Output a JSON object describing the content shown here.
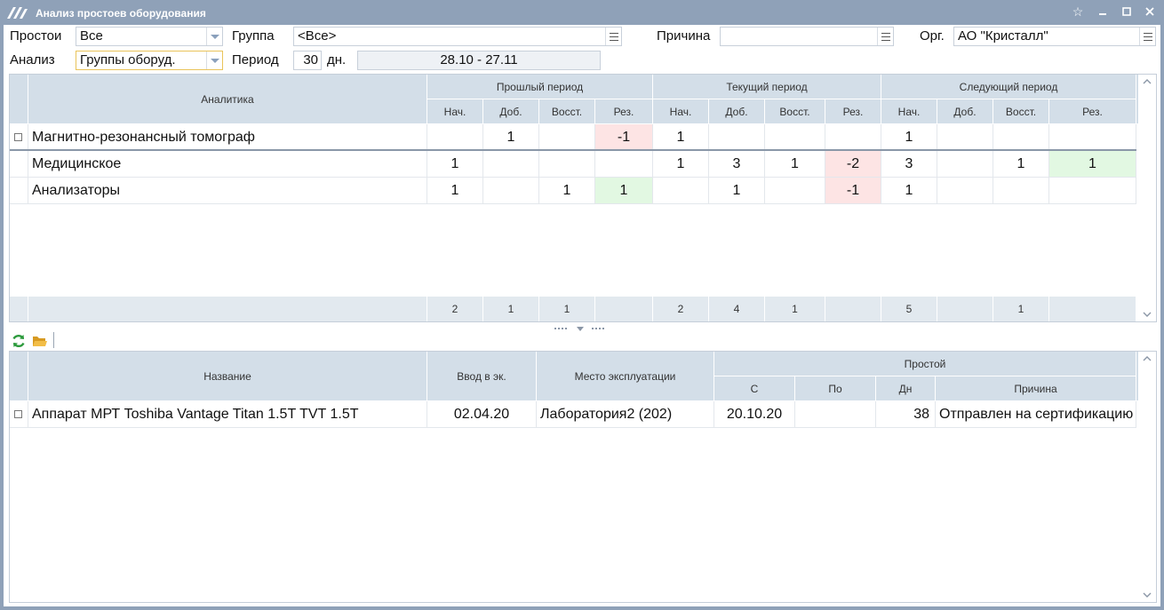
{
  "window": {
    "title": "Анализ простоев оборудования",
    "logo_icon": "app-logo-icon",
    "buttons": [
      "favorite-icon",
      "minimize-icon",
      "maximize-icon",
      "close-icon"
    ]
  },
  "filters": {
    "downtime_label": "Простои",
    "downtime_value": "Все",
    "group_label": "Группа",
    "group_value": "<Все>",
    "reason_label": "Причина",
    "reason_value": "",
    "org_label": "Орг.",
    "org_value": "АО \"Кристалл\"",
    "analysis_label": "Анализ",
    "analysis_value": "Группы оборуд.",
    "period_label": "Период",
    "period_days": "30",
    "period_unit": "дн.",
    "period_range": "28.10 - 27.11"
  },
  "top_table": {
    "analytics_header": "Аналитика",
    "groups": [
      "Прошлый период",
      "Текущий период",
      "Следующий период"
    ],
    "subheaders": [
      "Нач.",
      "Доб.",
      "Восст.",
      "Рез.",
      "Нач.",
      "Доб.",
      "Восст.",
      "Рез.",
      "Нач.",
      "Доб.",
      "Восст.",
      "Рез."
    ],
    "rows": [
      {
        "name": "Магнитно-резонансный томограф",
        "checkbox": true,
        "values": [
          "",
          "1",
          "",
          "-1",
          "1",
          "",
          "",
          "",
          "1",
          "",
          "",
          ""
        ]
      },
      {
        "name": "Медицинское",
        "checkbox": false,
        "values": [
          "1",
          "",
          "",
          "",
          "1",
          "3",
          "1",
          "-2",
          "3",
          "",
          "1",
          "1"
        ]
      },
      {
        "name": "Анализаторы",
        "checkbox": false,
        "values": [
          "1",
          "",
          "1",
          "1",
          "",
          "1",
          "",
          "-1",
          "1",
          "",
          "",
          ""
        ]
      }
    ],
    "totals": [
      "2",
      "1",
      "1",
      "",
      "2",
      "4",
      "1",
      "",
      "5",
      "",
      "1",
      ""
    ]
  },
  "toolbar": {
    "refresh_icon": "refresh-icon",
    "open_icon": "folder-open-icon"
  },
  "bottom_table": {
    "headers": {
      "name": "Название",
      "commissioned": "Ввод в эк.",
      "location": "Место эксплуатации",
      "downtime": "Простой",
      "from": "С",
      "to": "По",
      "days": "Дн",
      "reason": "Причина"
    },
    "rows": [
      {
        "name": "Аппарат МРТ Toshiba Vantage Titan 1.5T TVT 1.5T",
        "commissioned": "02.04.20",
        "location": "Лаборатория2 (202)",
        "from": "20.10.20",
        "to": "",
        "days": "38",
        "reason": "Отправлен на сертификацию"
      }
    ]
  }
}
